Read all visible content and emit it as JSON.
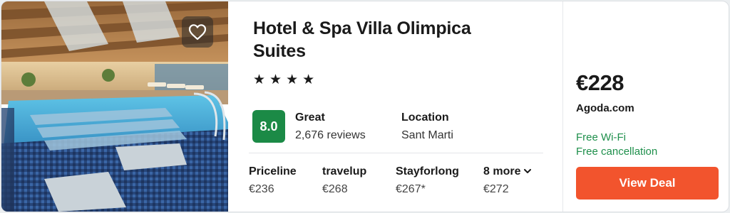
{
  "hotel": {
    "title_line1": "Hotel & Spa Villa Olimpica",
    "title_line2": "Suites",
    "stars": "★★★★",
    "star_count": 4
  },
  "rating": {
    "score": "8.0",
    "word": "Great",
    "reviews": "2,676 reviews",
    "badge_color": "#1b8a46"
  },
  "location": {
    "heading": "Location",
    "value": "Sant Marti"
  },
  "providers": [
    {
      "name": "Priceline",
      "price": "€236"
    },
    {
      "name": "travelup",
      "price": "€268"
    },
    {
      "name": "Stayforlong",
      "price": "€267*"
    },
    {
      "name": "8 more",
      "price": "€272"
    }
  ],
  "deal": {
    "price": "€228",
    "site": "Agoda.com",
    "amenities": [
      "Free Wi-Fi",
      "Free cancellation"
    ],
    "button_label": "View Deal",
    "button_color": "#f2542d",
    "amenity_color": "#1e8f4b"
  },
  "icons": {
    "favorite": "heart-outline-icon",
    "more": "chevron-down-icon"
  }
}
